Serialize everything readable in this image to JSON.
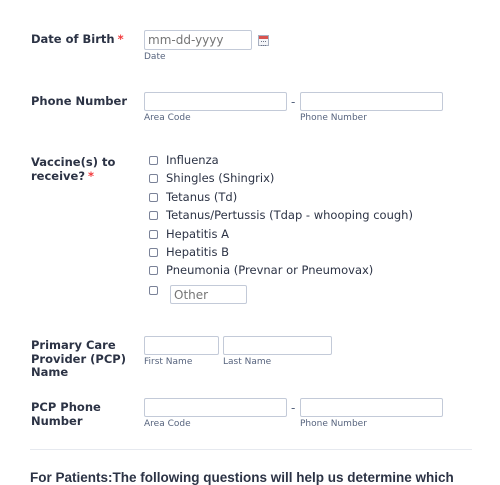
{
  "dob": {
    "label": "Date of Birth",
    "required_mark": "*",
    "placeholder": "mm-dd-yyyy",
    "sublabel": "Date",
    "calendar_icon": "calendar-icon"
  },
  "phone": {
    "label": "Phone Number",
    "separator": "-",
    "area_sublabel": "Area Code",
    "number_sublabel": "Phone Number"
  },
  "vaccines": {
    "label_line1": "Vaccine(s) to",
    "label_line2": "receive?",
    "required_mark": "*",
    "options": [
      "Influenza",
      "Shingles (Shingrix)",
      "Tetanus (Td)",
      "Tetanus/Pertussis (Tdap - whooping cough)",
      "Hepatitis A",
      "Hepatitis B",
      "Pneumonia (Prevnar or Pneumovax)"
    ],
    "other_placeholder": "Other"
  },
  "pcp": {
    "label_line1": "Primary Care",
    "label_line2": "Provider (PCP)",
    "label_line3": "Name",
    "first_sublabel": "First Name",
    "last_sublabel": "Last Name"
  },
  "pcp_phone": {
    "label_line1": "PCP Phone",
    "label_line2": "Number",
    "separator": "-",
    "area_sublabel": "Area Code",
    "number_sublabel": "Phone Number"
  },
  "section": {
    "heading": "For Patients:The following questions will help us determine which"
  },
  "colors": {
    "required": "#f23a3c",
    "text": "#2c3345",
    "border": "#c3cad8"
  }
}
